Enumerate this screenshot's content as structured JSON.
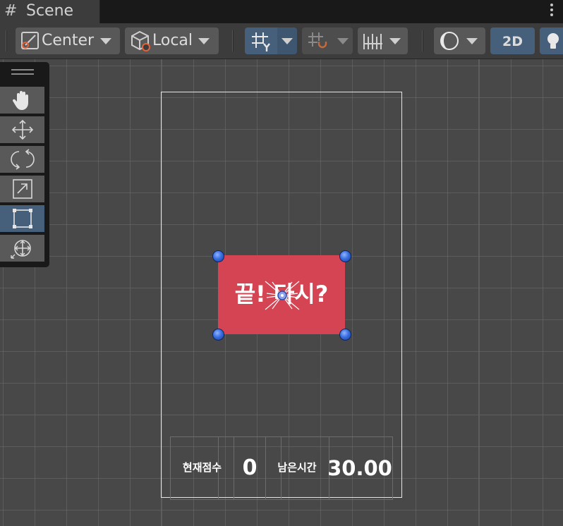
{
  "tab": {
    "icon": "grid-hash-icon",
    "label": "Scene"
  },
  "toolbar": {
    "pivot_mode": "Center",
    "pivot_rotation": "Local",
    "mode_2d": "2D"
  },
  "tools": [
    "view-tool",
    "move-tool",
    "rotate-tool",
    "scale-tool",
    "rect-tool",
    "transform-tool"
  ],
  "scene": {
    "end_button_text": "끝! 다시?",
    "hud": {
      "score_label": "현재점수",
      "score_value": "0",
      "time_label": "남은시간",
      "time_value": "30.00"
    }
  },
  "colors": {
    "end_panel": "#d44452",
    "selection_handle": "#3a6fe0",
    "active_tool": "#46607c"
  }
}
